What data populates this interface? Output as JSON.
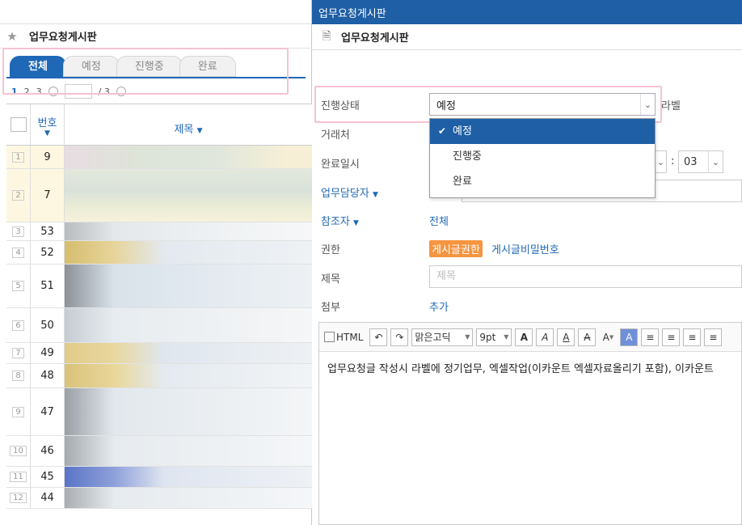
{
  "left_window": {
    "board_title": "업무요청게시판",
    "tabs": [
      {
        "label": "전체",
        "active": true
      },
      {
        "label": "예정",
        "active": false
      },
      {
        "label": "진행중",
        "active": false
      },
      {
        "label": "완료",
        "active": false
      }
    ],
    "pager": {
      "pages": [
        "1",
        "2",
        "3"
      ],
      "current": "1",
      "total": "/ 3"
    },
    "grid": {
      "col_num": "번호",
      "col_title": "제목",
      "rows": [
        {
          "idx": "1",
          "num": "9"
        },
        {
          "idx": "2",
          "num": "7"
        },
        {
          "idx": "3",
          "num": "53"
        },
        {
          "idx": "4",
          "num": "52"
        },
        {
          "idx": "5",
          "num": "51"
        },
        {
          "idx": "6",
          "num": "50"
        },
        {
          "idx": "7",
          "num": "49"
        },
        {
          "idx": "8",
          "num": "48"
        },
        {
          "idx": "9",
          "num": "47"
        },
        {
          "idx": "10",
          "num": "46"
        },
        {
          "idx": "11",
          "num": "45"
        },
        {
          "idx": "12",
          "num": "44"
        }
      ]
    }
  },
  "right_window": {
    "window_title": "업무요청게시판",
    "header_title": "업무요청게시판",
    "labels": {
      "status": "진행상태",
      "client": "거래처",
      "complete_date": "완료일시",
      "manager": "업무담당자",
      "participants": "참조자",
      "permission": "권한",
      "title": "제목",
      "attach": "첨부"
    },
    "status_select": {
      "value": "예정",
      "label_after": "라벨"
    },
    "status_options": [
      {
        "label": "예정",
        "selected": true
      },
      {
        "label": "진행중",
        "selected": false
      },
      {
        "label": "완료",
        "selected": false
      }
    ],
    "complete_minute": "03",
    "participants_value": "전체",
    "permission_badge": "게시글권한",
    "permission_password": "게시글비밀번호",
    "title_placeholder": "제목",
    "attach_value": "추가",
    "toolbar": {
      "html_label": "HTML",
      "font_name": "맑은고딕",
      "font_size": "9pt"
    },
    "editor_body": "업무요청글 작성시 라벨에 정기업무, 엑셀작업(이카운트 엑셀자료올리기 포함), 이카운트"
  },
  "colors": {
    "primary_blue": "#1e5fa6",
    "highlight_pink": "#f4c3d2",
    "badge_orange": "#f59540"
  },
  "icons": [
    "star-icon",
    "document-icon",
    "chevron-down-icon",
    "check-icon",
    "undo-icon",
    "redo-icon",
    "sort-down-icon"
  ]
}
